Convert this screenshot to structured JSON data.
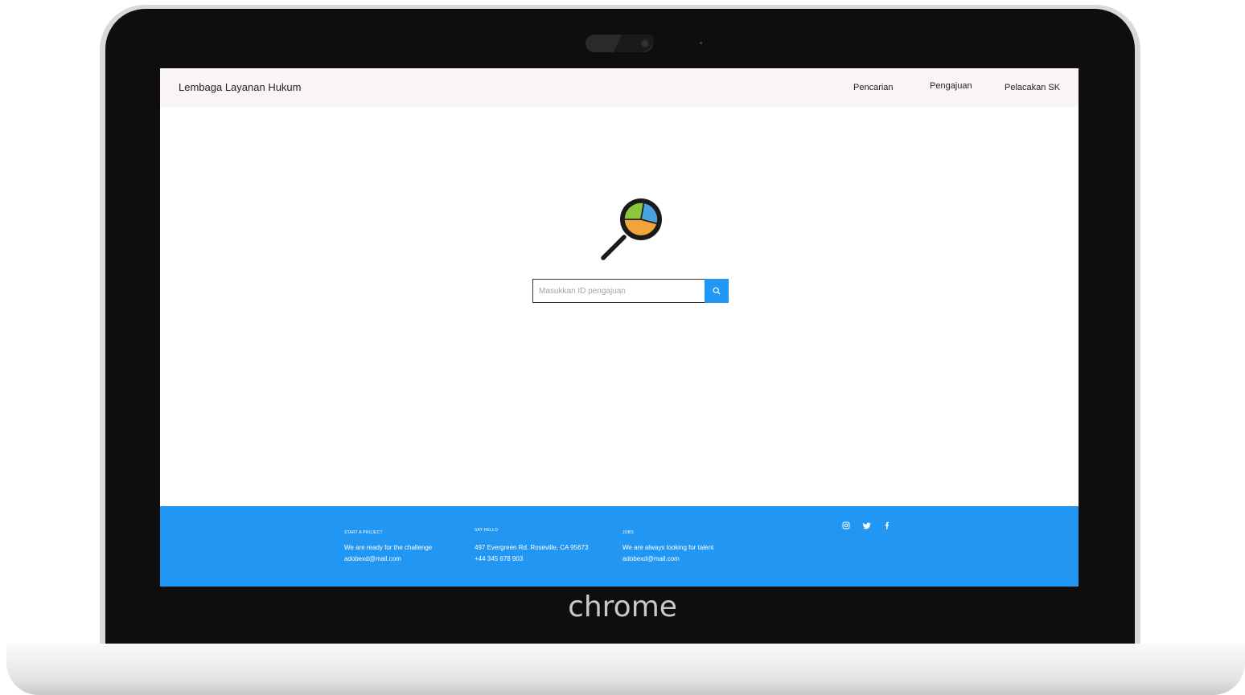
{
  "device": {
    "brand": "chrome"
  },
  "navbar": {
    "title": "Lembaga Layanan Hukum",
    "links": [
      {
        "label": "Pencarian"
      },
      {
        "label": "Pengajuan"
      },
      {
        "label": "Pelacakan SK"
      }
    ]
  },
  "hero": {
    "icon": "magnifier-pie-chart-icon",
    "pie_colors": [
      "#f2a33a",
      "#8cc63f",
      "#4aa3df"
    ]
  },
  "search": {
    "placeholder": "Masukkan ID pengajuan",
    "value": "",
    "button_icon": "search-icon",
    "button_color": "#2196f3"
  },
  "footer": {
    "color": "#2196f3",
    "columns": [
      {
        "heading": "START A PROJECT",
        "lines": [
          "We are ready for the challenge",
          "adobexd@mail.com"
        ]
      },
      {
        "heading": "SAY HELLO",
        "lines": [
          "497 Evergreen Rd. Roseville, CA 95673",
          "+44 345 678 903"
        ]
      },
      {
        "heading": "JOBS",
        "lines": [
          "We are always looking for talent",
          "adobexd@mail.com"
        ]
      }
    ],
    "social": [
      "instagram-icon",
      "twitter-icon",
      "facebook-icon"
    ]
  }
}
